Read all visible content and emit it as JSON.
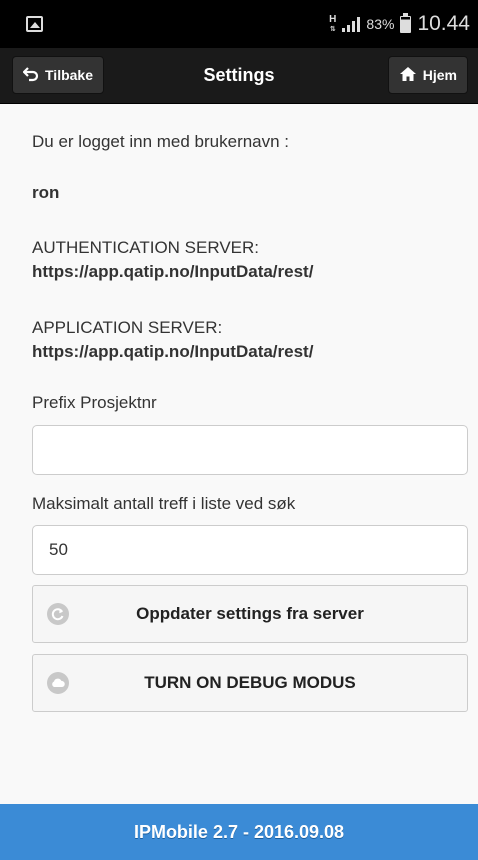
{
  "status_bar": {
    "network_type": "H",
    "battery_percent": "83%",
    "time": "10.44"
  },
  "header": {
    "title": "Settings",
    "back_label": "Tilbake",
    "home_label": "Hjem"
  },
  "content": {
    "logged_in_label": "Du er logget inn med brukernavn :",
    "username": "ron",
    "auth_server_label": "AUTHENTICATION SERVER:",
    "auth_server_url": "https://app.qatip.no/InputData/rest/",
    "app_server_label": "APPLICATION SERVER:",
    "app_server_url": "https://app.qatip.no/InputData/rest/",
    "prefix_label": "Prefix Prosjektnr",
    "prefix_value": "",
    "max_hits_label": "Maksimalt antall treff i liste ved søk",
    "max_hits_value": "50",
    "update_button": "Oppdater settings fra server",
    "debug_button": "TURN ON DEBUG MODUS"
  },
  "footer": {
    "text": "IPMobile 2.7 - 2016.09.08"
  },
  "colors": {
    "footer_bg": "#3b8bd6",
    "header_bg": "#1a1a1a",
    "status_bar_bg": "#000000"
  }
}
